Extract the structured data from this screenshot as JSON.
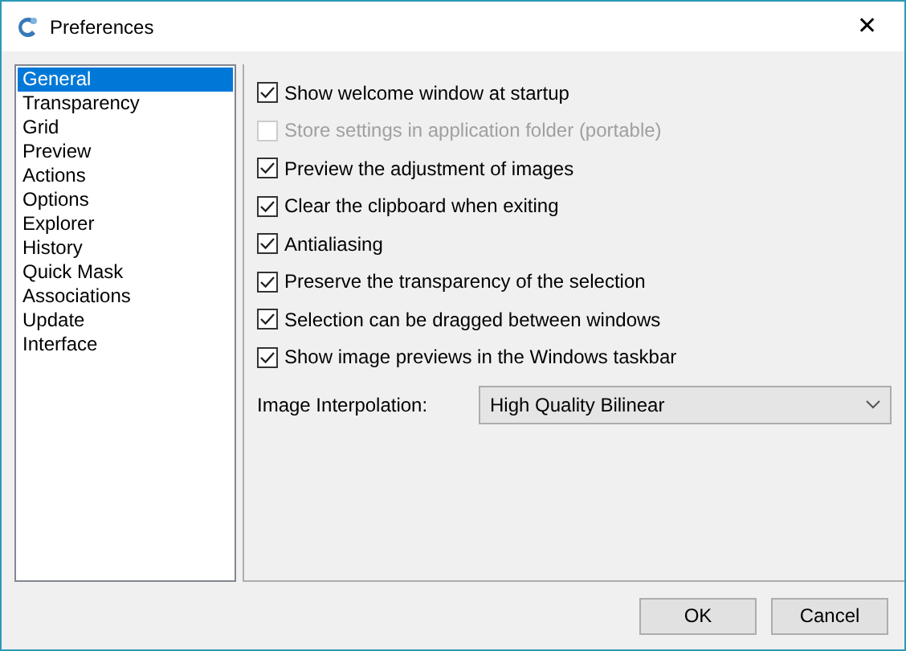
{
  "window": {
    "title": "Preferences",
    "close": "✕"
  },
  "sidebar": {
    "items": [
      {
        "label": "General",
        "selected": true
      },
      {
        "label": "Transparency",
        "selected": false
      },
      {
        "label": "Grid",
        "selected": false
      },
      {
        "label": "Preview",
        "selected": false
      },
      {
        "label": "Actions",
        "selected": false
      },
      {
        "label": "Options",
        "selected": false
      },
      {
        "label": "Explorer",
        "selected": false
      },
      {
        "label": "History",
        "selected": false
      },
      {
        "label": "Quick Mask",
        "selected": false
      },
      {
        "label": "Associations",
        "selected": false
      },
      {
        "label": "Update",
        "selected": false
      },
      {
        "label": "Interface",
        "selected": false
      }
    ]
  },
  "options": [
    {
      "label": "Show welcome window at startup",
      "checked": true,
      "disabled": false
    },
    {
      "label": "Store settings in application folder (portable)",
      "checked": false,
      "disabled": true
    },
    {
      "label": "Preview the adjustment of images",
      "checked": true,
      "disabled": false
    },
    {
      "label": "Clear the clipboard when exiting",
      "checked": true,
      "disabled": false
    },
    {
      "label": "Antialiasing",
      "checked": true,
      "disabled": false
    },
    {
      "label": "Preserve the transparency of the selection",
      "checked": true,
      "disabled": false
    },
    {
      "label": "Selection can be dragged between windows",
      "checked": true,
      "disabled": false
    },
    {
      "label": "Show image previews in the Windows taskbar",
      "checked": true,
      "disabled": false
    }
  ],
  "interpolation": {
    "label": "Image Interpolation:",
    "value": "High Quality Bilinear"
  },
  "buttons": [
    "OK",
    "Cancel"
  ]
}
